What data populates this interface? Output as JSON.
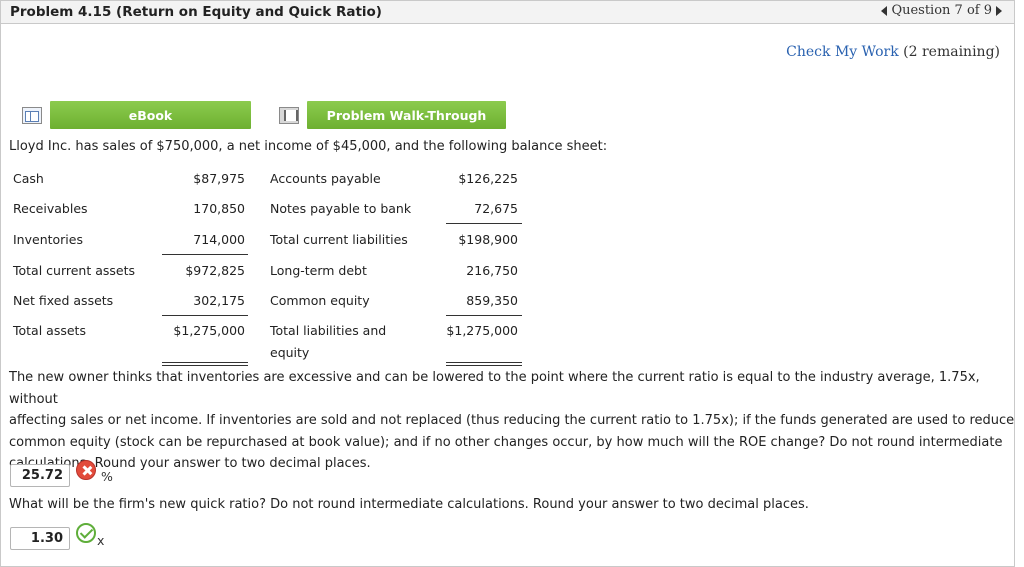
{
  "header": {
    "title": "Problem 4.15 (Return on Equity and Quick Ratio)",
    "question_nav": "Question 7 of 9"
  },
  "check_work": {
    "link": "Check My Work",
    "remaining": "(2 remaining)"
  },
  "buttons": {
    "ebook": "eBook",
    "walkthrough": "Problem Walk-Through"
  },
  "intro": "Lloyd Inc. has sales of $750,000, a net income of $45,000, and the following balance sheet:",
  "balance_sheet": {
    "assets": [
      {
        "label": "Cash",
        "value": "$87,975"
      },
      {
        "label": "Receivables",
        "value": "170,850"
      },
      {
        "label": "Inventories",
        "value": "714,000"
      },
      {
        "label": "Total current assets",
        "value": "$972,825"
      },
      {
        "label": "Net fixed assets",
        "value": "302,175"
      },
      {
        "label": "Total assets",
        "value": "$1,275,000"
      }
    ],
    "liabilities": [
      {
        "label": "Accounts payable",
        "value": "$126,225"
      },
      {
        "label": "Notes payable to bank",
        "value": "72,675"
      },
      {
        "label": "Total current liabilities",
        "value": "$198,900"
      },
      {
        "label": "Long-term debt",
        "value": "216,750"
      },
      {
        "label": "Common equity",
        "value": "859,350"
      },
      {
        "label": "Total liabilities and",
        "value": "$1,275,000"
      }
    ],
    "liabilities_total_cont": "equity"
  },
  "question1": {
    "lines": [
      "The new owner thinks that inventories are excessive and can be lowered to the point where the current ratio is equal to the industry average, 1.75x, without",
      "affecting sales or net income. If inventories are sold and not replaced (thus reducing the current ratio to 1.75x); if the funds generated are used to reduce",
      "common equity (stock can be repurchased at book value); and if no other changes occur, by how much will the ROE change? Do not round intermediate",
      "calculations. Round your answer to two decimal places."
    ],
    "answer": "25.72",
    "unit": "%",
    "status": "incorrect"
  },
  "question2": {
    "text": "What will be the firm's new quick ratio? Do not round intermediate calculations. Round your answer to two decimal places.",
    "answer": "1.30",
    "unit": "x",
    "status": "correct"
  },
  "colors": {
    "button_green": "#7bbd3f",
    "link_blue": "#2a62b0",
    "error_red": "#e24b3b",
    "check_green": "#5fae3a"
  }
}
